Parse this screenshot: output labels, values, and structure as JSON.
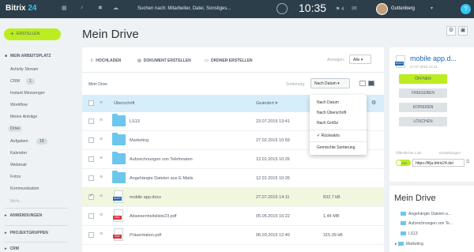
{
  "topbar": {
    "logo": "Bitrix",
    "logo_num": "24",
    "search_placeholder": "Suchen nach: Mitarbeiter, Datei, Sonstiges...",
    "time": "10:35",
    "flag_count": "4",
    "user_name": "Guttenberg",
    "help": "?"
  },
  "sidebar": {
    "create_label": "ERSTELLEN",
    "section1": "MEIN ARBEITSPLATZ",
    "items": [
      {
        "label": "Activity Stream"
      },
      {
        "label": "CRM",
        "badge": "1"
      },
      {
        "label": "Instant Messenger"
      },
      {
        "label": "Workflow"
      },
      {
        "label": "Meine Anträge"
      },
      {
        "label": "Drive",
        "active": true
      },
      {
        "label": "Aufgaben",
        "badge": "19"
      },
      {
        "label": "Kalender"
      },
      {
        "label": "Webmail"
      },
      {
        "label": "Fotos"
      },
      {
        "label": "Kommunikation"
      }
    ],
    "more": "Mehr...",
    "section2": "ANWENDUNGEN",
    "section3": "PROJEKTGRUPPEN",
    "section4": "CRM"
  },
  "page": {
    "title": "Mein Drive"
  },
  "toolbar": {
    "upload": "HOCHLADEN",
    "create_doc": "DOKUMENT ERSTELLEN",
    "create_folder": "ORDNER ERSTELLEN",
    "show_label": "Anzeigen:",
    "show_value": "Alle"
  },
  "breadcrumb": "Mein Drive",
  "sort": {
    "label": "Sortierung:",
    "value": "Nach Datum"
  },
  "table": {
    "headers": {
      "name": "Überschrift",
      "changed": "Geändert"
    },
    "rows": [
      {
        "name": "LS13",
        "date": "23.07.2015 13:41",
        "size": "",
        "type": "folder",
        "selected": false
      },
      {
        "name": "Marketing",
        "date": "27.02.2015 10:59",
        "size": "",
        "type": "folder",
        "selected": false
      },
      {
        "name": "Aufzeichnungen von Telefonaten",
        "date": "12.01.2015 10:26",
        "size": "",
        "type": "folder",
        "selected": false
      },
      {
        "name": "Angehängte Dateien aus E-Mails",
        "date": "12.01.2015 10:26",
        "size": "",
        "type": "folder",
        "selected": false
      },
      {
        "name": "mobile app.docx",
        "date": "27.07.2015 14:11",
        "size": "832.7 kB",
        "type": "docx",
        "selected": true
      },
      {
        "name": "Abwesenheitsliste23.pdf",
        "date": "05.05.2015 16:22",
        "size": "1,44 MB",
        "type": "pdf",
        "selected": false
      },
      {
        "name": "Präsentation.pdf",
        "date": "06.03.2015 12:40",
        "size": "315.39 kB",
        "type": "pdf",
        "selected": false
      }
    ]
  },
  "sort_menu": {
    "items": [
      "Nach Datum",
      "Nach Überschrift",
      "Nach Größe"
    ],
    "desc": "Rückwärts",
    "mixed": "Gemischte Sortierung"
  },
  "right": {
    "file_title": "mobile app.d...",
    "file_date": "27.07.2015 14:11",
    "btn_open": "ÖFFNEN",
    "btn_share": "FREIGEBEN",
    "btn_copy": "KOPIEREN",
    "btn_delete": "LÖSCHEN",
    "public_link_label": "Öffentlicher Link",
    "settings_label": "Einstellungen",
    "toggle": "EIN",
    "link": "https://lilja.bitrix24.de/",
    "tree_title": "Mein Drive",
    "tree_items": [
      "Angehängte Dateien a...",
      "Aufzeichnungen von Te...",
      "LS13",
      "Marketing"
    ]
  },
  "colors": {
    "accent": "#bbed21",
    "topbar": "#2c3e4a",
    "header": "#d6eef9",
    "selected_row": "#f1f7de"
  }
}
